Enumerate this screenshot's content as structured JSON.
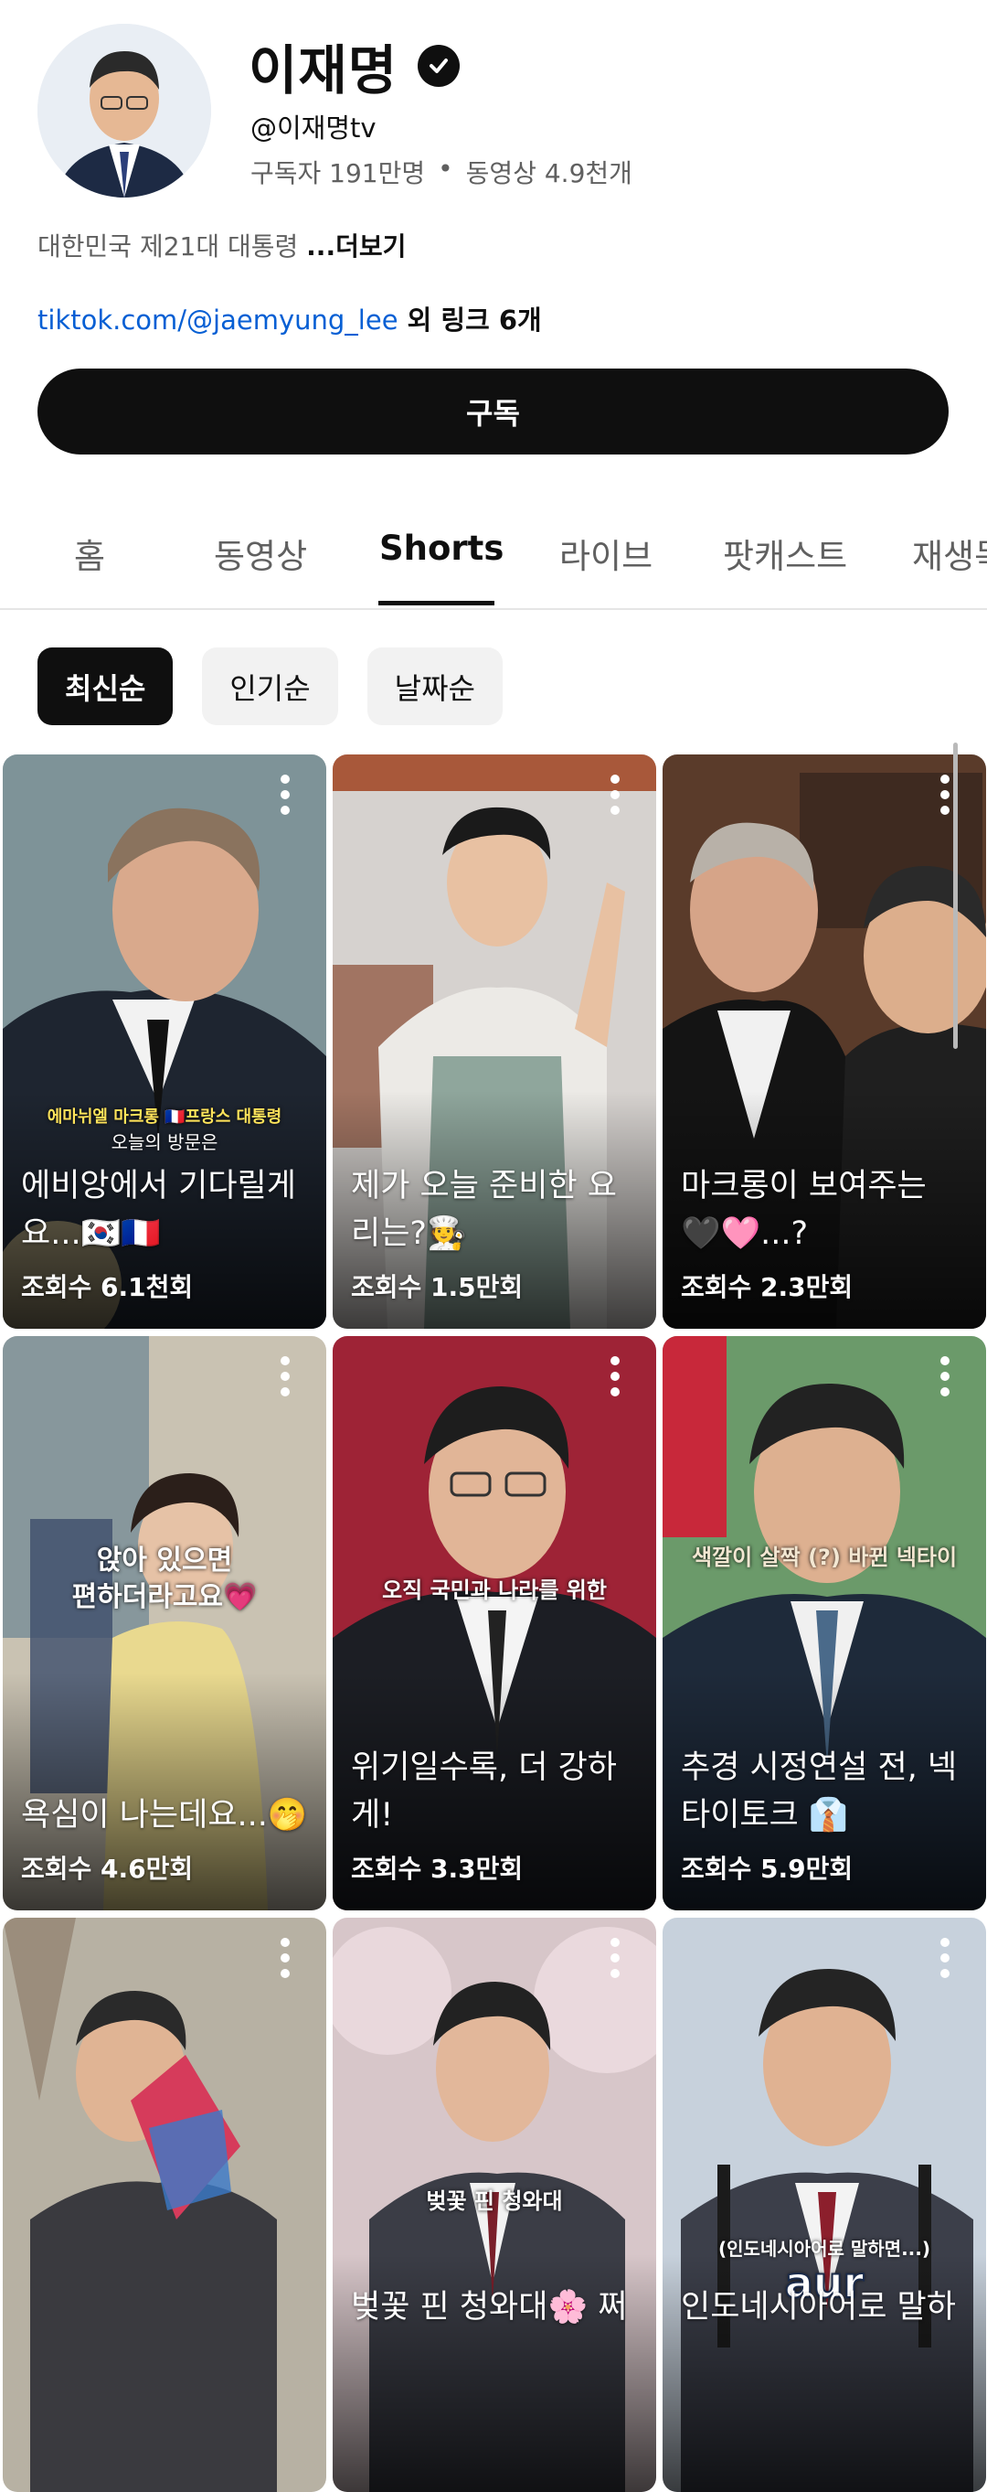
{
  "channel": {
    "name": "이재명",
    "handle": "@이재명tv",
    "subscribers": "구독자 191만명",
    "separator": "•",
    "videos": "동영상 4.9천개",
    "description": "대한민국 제21대 대통령 ",
    "more": "...더보기",
    "link": "tiktok.com/@jaemyung_lee",
    "link_more": " 외 링크 6개",
    "subscribe_label": "구독"
  },
  "tabs": [
    "홈",
    "동영상",
    "Shorts",
    "라이브",
    "팟캐스트",
    "재생목록"
  ],
  "active_tab": "Shorts",
  "chips": [
    "최신순",
    "인기순",
    "날짜순"
  ],
  "active_chip": "최신순",
  "shorts": [
    {
      "overlay": "에마뉘엘 마크롱 🇫🇷프랑스 대통령",
      "overlay2": "오늘의 방문은",
      "title": "에비앙에서 기다릴게요...🇰🇷🇫🇷",
      "views": "조회수 6.1천회"
    },
    {
      "overlay": "",
      "overlay2": "",
      "title": "제가 오늘 준비한 요리는?🧑‍🍳",
      "views": "조회수 1.5만회"
    },
    {
      "overlay": "",
      "overlay2": "",
      "title": "마크롱이 보여주는 🖤🩷...?",
      "views": "조회수 2.3만회"
    },
    {
      "overlay": "앉아 있으면",
      "overlay2": "편하더라고요💗",
      "title": "욕심이 나는데요...🤭",
      "views": "조회수 4.6만회"
    },
    {
      "overlay": "오직 국민과 나라를 위한",
      "overlay2": "",
      "title": "위기일수록, 더 강하게!",
      "views": "조회수 3.3만회"
    },
    {
      "overlay": "색깔이 살짝 (?) 바뀐 넥타이",
      "overlay2": "",
      "title": "추경 시정연설 전, 넥타이토크 👔",
      "views": "조회수 5.9만회"
    },
    {
      "overlay": "",
      "overlay2": "",
      "title": "",
      "views": ""
    },
    {
      "overlay": "벚꽃 핀 청와대",
      "overlay2": "",
      "title": "벚꽃 핀 청와대🌸 쩌",
      "views": ""
    },
    {
      "overlay": "(인도네시아어로 말하면...)",
      "overlay2": "aur",
      "title": "인도네시아어로 말하",
      "views": ""
    }
  ],
  "colors": {
    "accent": "#0f0f0f",
    "link": "#065fd4",
    "muted": "#606060"
  }
}
